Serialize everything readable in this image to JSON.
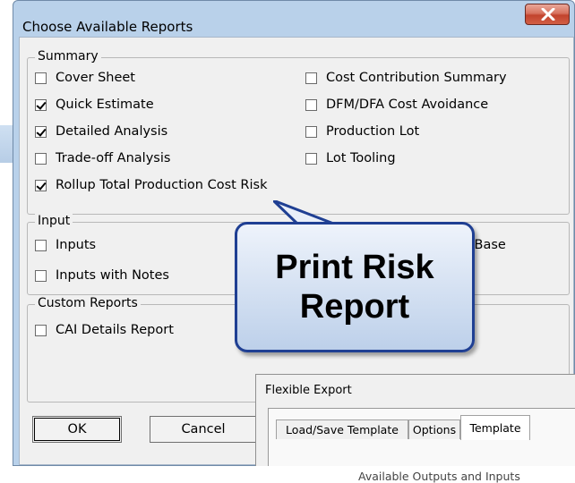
{
  "dialog": {
    "title": "Choose Available Reports",
    "close_symbol": "X"
  },
  "groups": {
    "summary": {
      "title": "Summary",
      "left_items": [
        {
          "label": "Cover Sheet",
          "checked": false
        },
        {
          "label": "Quick Estimate",
          "checked": true
        },
        {
          "label": "Detailed Analysis",
          "checked": true
        },
        {
          "label": "Trade-off Analysis",
          "checked": false
        },
        {
          "label": "Rollup Total Production Cost Risk",
          "checked": true
        }
      ],
      "right_items": [
        {
          "label": "Cost Contribution Summary",
          "checked": false
        },
        {
          "label": "DFM/DFA Cost Avoidance",
          "checked": false
        },
        {
          "label": "Production Lot",
          "checked": false
        },
        {
          "label": "Lot Tooling",
          "checked": false
        }
      ]
    },
    "input": {
      "title": "Input",
      "items": [
        {
          "label": "Inputs",
          "checked": false
        },
        {
          "label": "Inputs with Notes",
          "checked": false
        }
      ],
      "partial_right_text": "e Base"
    },
    "custom": {
      "title": "Custom Reports",
      "items": [
        {
          "label": "CAI Details Report",
          "checked": false
        }
      ]
    }
  },
  "buttons": {
    "ok": "OK",
    "cancel": "Cancel"
  },
  "callout": {
    "line1": "Print Risk",
    "line2": "Report"
  },
  "flexible_export": {
    "title": "Flexible Export",
    "tabs": [
      "Load/Save Template",
      "Options",
      "Template"
    ],
    "active_tab": "Template",
    "caption": "Available Outputs and Inputs"
  },
  "colors": {
    "titlebar": "#b9d1ea",
    "client": "#f0f0f0",
    "callout_border": "#1f3f93",
    "close_button": "#c2432d"
  }
}
